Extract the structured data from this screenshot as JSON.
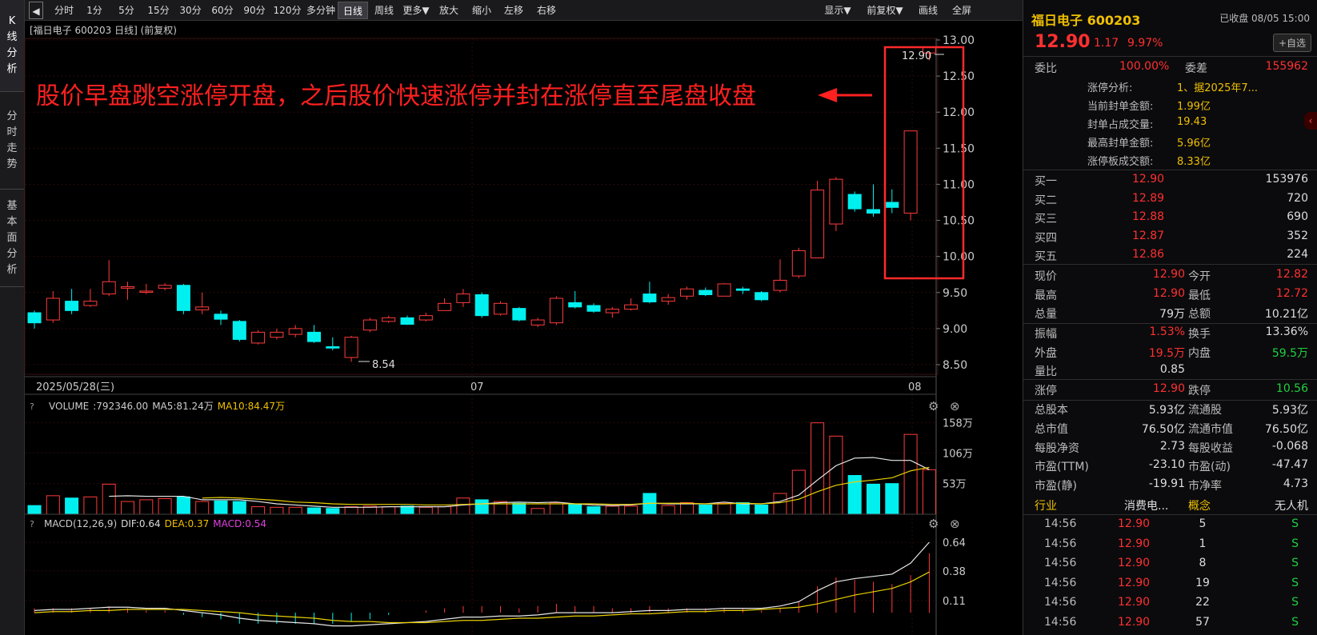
{
  "sidebar": {
    "tabs": [
      {
        "label": "K线分析",
        "active": true
      },
      {
        "label": "分时走势",
        "active": false
      },
      {
        "label": "基本面分析",
        "active": false
      }
    ]
  },
  "toolbar": {
    "left": [
      "分时",
      "1分",
      "5分",
      "15分",
      "30分",
      "60分",
      "90分",
      "120分",
      "多分钟",
      "日线",
      "周线",
      "更多▼",
      "放大",
      "缩小",
      "左移",
      "右移"
    ],
    "active": "日线",
    "right": [
      "显示▼",
      "前复权▼",
      "画线",
      "全屏"
    ]
  },
  "chart": {
    "title": "[福日电子 600203 日线]  (前复权)",
    "price_ticks": [
      "13.00",
      "12.50",
      "12.00",
      "11.50",
      "11.00",
      "10.50",
      "10.00",
      "9.50",
      "9.00",
      "8.50"
    ],
    "date_labels": [
      "2025/05/28(三)",
      "07",
      "08"
    ],
    "annotation": "股价早盘跳空涨停开盘，之后股价快速涨停并封在涨停直至尾盘收盘",
    "high_label": "12.90",
    "low_label": "8.54"
  },
  "volume": {
    "label": "VOLUME",
    "value": ":792346.00",
    "ma5": "MA5:81.24万",
    "ma10": "MA10:84.47万",
    "ticks": [
      "158万",
      "106万",
      "53万"
    ]
  },
  "macd": {
    "label": "MACD(12,26,9)",
    "dif": "DIF:0.64",
    "dea": "DEA:0.37",
    "macd": "MACD:0.54",
    "ticks": [
      "0.64",
      "0.38",
      "0.11"
    ]
  },
  "chart_data": {
    "type": "candlestick",
    "title": "福日电子 600203 日线",
    "y_range": [
      8.5,
      13.0
    ],
    "candles": [
      {
        "o": 9.22,
        "c": 9.08,
        "h": 9.25,
        "l": 9.0
      },
      {
        "o": 9.12,
        "c": 9.42,
        "h": 9.52,
        "l": 9.08
      },
      {
        "o": 9.38,
        "c": 9.25,
        "h": 9.55,
        "l": 9.2
      },
      {
        "o": 9.32,
        "c": 9.38,
        "h": 9.55,
        "l": 9.3
      },
      {
        "o": 9.48,
        "c": 9.65,
        "h": 9.95,
        "l": 9.45
      },
      {
        "o": 9.56,
        "c": 9.58,
        "h": 9.65,
        "l": 9.4
      },
      {
        "o": 9.52,
        "c": 9.52,
        "h": 9.62,
        "l": 9.48
      },
      {
        "o": 9.56,
        "c": 9.6,
        "h": 9.63,
        "l": 9.53
      },
      {
        "o": 9.6,
        "c": 9.25,
        "h": 9.62,
        "l": 9.2
      },
      {
        "o": 9.26,
        "c": 9.3,
        "h": 9.5,
        "l": 9.2
      },
      {
        "o": 9.2,
        "c": 9.13,
        "h": 9.25,
        "l": 9.05
      },
      {
        "o": 9.1,
        "c": 8.85,
        "h": 9.12,
        "l": 8.82
      },
      {
        "o": 8.8,
        "c": 8.95,
        "h": 8.98,
        "l": 8.78
      },
      {
        "o": 8.88,
        "c": 8.95,
        "h": 9.0,
        "l": 8.85
      },
      {
        "o": 8.92,
        "c": 9.0,
        "h": 9.05,
        "l": 8.88
      },
      {
        "o": 8.95,
        "c": 8.82,
        "h": 9.05,
        "l": 8.8
      },
      {
        "o": 8.75,
        "c": 8.73,
        "h": 8.88,
        "l": 8.7
      },
      {
        "o": 8.6,
        "c": 8.88,
        "h": 8.9,
        "l": 8.54
      },
      {
        "o": 8.98,
        "c": 9.12,
        "h": 9.15,
        "l": 8.95
      },
      {
        "o": 9.1,
        "c": 9.15,
        "h": 9.18,
        "l": 9.08
      },
      {
        "o": 9.15,
        "c": 9.06,
        "h": 9.18,
        "l": 9.05
      },
      {
        "o": 9.12,
        "c": 9.18,
        "h": 9.22,
        "l": 9.1
      },
      {
        "o": 9.25,
        "c": 9.35,
        "h": 9.42,
        "l": 9.25
      },
      {
        "o": 9.36,
        "c": 9.48,
        "h": 9.55,
        "l": 9.3
      },
      {
        "o": 9.47,
        "c": 9.18,
        "h": 9.5,
        "l": 9.15
      },
      {
        "o": 9.2,
        "c": 9.35,
        "h": 9.38,
        "l": 9.18
      },
      {
        "o": 9.28,
        "c": 9.12,
        "h": 9.3,
        "l": 9.1
      },
      {
        "o": 9.05,
        "c": 9.12,
        "h": 9.15,
        "l": 9.02
      },
      {
        "o": 9.08,
        "c": 9.42,
        "h": 9.45,
        "l": 9.05
      },
      {
        "o": 9.36,
        "c": 9.3,
        "h": 9.52,
        "l": 9.28
      },
      {
        "o": 9.32,
        "c": 9.24,
        "h": 9.35,
        "l": 9.22
      },
      {
        "o": 9.22,
        "c": 9.27,
        "h": 9.3,
        "l": 9.15
      },
      {
        "o": 9.27,
        "c": 9.33,
        "h": 9.42,
        "l": 9.25
      },
      {
        "o": 9.48,
        "c": 9.37,
        "h": 9.65,
        "l": 9.35
      },
      {
        "o": 9.38,
        "c": 9.43,
        "h": 9.48,
        "l": 9.33
      },
      {
        "o": 9.45,
        "c": 9.55,
        "h": 9.58,
        "l": 9.4
      },
      {
        "o": 9.53,
        "c": 9.47,
        "h": 9.57,
        "l": 9.45
      },
      {
        "o": 9.45,
        "c": 9.62,
        "h": 9.63,
        "l": 9.45
      },
      {
        "o": 9.55,
        "c": 9.53,
        "h": 9.58,
        "l": 9.48
      },
      {
        "o": 9.5,
        "c": 9.4,
        "h": 9.52,
        "l": 9.38
      },
      {
        "o": 9.53,
        "c": 9.67,
        "h": 9.96,
        "l": 9.5
      },
      {
        "o": 9.73,
        "c": 10.08,
        "h": 10.12,
        "l": 9.7
      },
      {
        "o": 9.98,
        "c": 10.92,
        "h": 11.05,
        "l": 9.98
      },
      {
        "o": 10.45,
        "c": 11.07,
        "h": 11.1,
        "l": 10.35
      },
      {
        "o": 10.86,
        "c": 10.66,
        "h": 10.9,
        "l": 10.62
      },
      {
        "o": 10.65,
        "c": 10.6,
        "h": 11.0,
        "l": 10.55
      },
      {
        "o": 10.75,
        "c": 10.68,
        "h": 10.93,
        "l": 10.6
      },
      {
        "o": 10.6,
        "c": 11.74,
        "h": 11.74,
        "l": 10.5
      },
      {
        "o": 12.82,
        "c": 12.9,
        "h": 12.9,
        "l": 12.72
      }
    ],
    "volume": [
      15,
      32,
      28,
      30,
      52,
      22,
      25,
      27,
      30,
      22,
      23,
      22,
      13,
      12,
      12,
      11,
      10,
      13,
      14,
      13,
      14,
      12,
      13,
      28,
      25,
      22,
      19,
      10,
      20,
      18,
      13,
      14,
      14,
      36,
      15,
      20,
      16,
      19,
      20,
      16,
      36,
      76,
      158,
      135,
      67,
      52,
      53,
      138,
      77
    ],
    "volume_ma5": [
      null,
      null,
      null,
      null,
      31,
      32,
      31,
      31,
      31,
      25,
      25,
      25,
      22,
      18,
      16,
      14,
      12,
      12,
      12,
      13,
      13,
      13,
      13,
      16,
      18,
      20,
      21,
      20,
      21,
      18,
      16,
      15,
      16,
      19,
      18,
      18,
      18,
      21,
      18,
      18,
      22,
      33,
      59,
      84,
      97,
      98,
      93,
      93,
      77
    ],
    "volume_ma10": [
      null,
      null,
      null,
      null,
      null,
      null,
      null,
      null,
      null,
      28,
      29,
      28,
      26,
      24,
      21,
      20,
      18,
      17,
      17,
      17,
      17,
      16,
      16,
      17,
      18,
      18,
      18,
      18,
      18,
      18,
      18,
      17,
      17,
      19,
      19,
      19,
      18,
      18,
      19,
      18,
      20,
      26,
      39,
      50,
      56,
      59,
      63,
      75,
      81
    ],
    "macd": {
      "dif": [
        0.02,
        0.03,
        0.03,
        0.04,
        0.05,
        0.05,
        0.04,
        0.04,
        0.02,
        0.0,
        -0.02,
        -0.05,
        -0.07,
        -0.08,
        -0.09,
        -0.1,
        -0.12,
        -0.12,
        -0.11,
        -0.1,
        -0.09,
        -0.08,
        -0.06,
        -0.04,
        -0.04,
        -0.03,
        -0.03,
        -0.02,
        0.0,
        0.0,
        0.0,
        0.0,
        0.01,
        0.02,
        0.02,
        0.03,
        0.03,
        0.04,
        0.04,
        0.04,
        0.06,
        0.1,
        0.2,
        0.28,
        0.31,
        0.33,
        0.35,
        0.45,
        0.64
      ],
      "dea": [
        0.0,
        0.01,
        0.01,
        0.02,
        0.02,
        0.03,
        0.03,
        0.03,
        0.03,
        0.02,
        0.01,
        0.0,
        -0.02,
        -0.03,
        -0.04,
        -0.05,
        -0.07,
        -0.08,
        -0.08,
        -0.09,
        -0.09,
        -0.09,
        -0.08,
        -0.07,
        -0.07,
        -0.06,
        -0.05,
        -0.05,
        -0.04,
        -0.03,
        -0.03,
        -0.02,
        -0.01,
        -0.01,
        0.0,
        0.01,
        0.01,
        0.02,
        0.02,
        0.03,
        0.04,
        0.05,
        0.08,
        0.12,
        0.16,
        0.19,
        0.22,
        0.28,
        0.37
      ],
      "hist": [
        0.04,
        0.04,
        0.04,
        0.04,
        0.06,
        0.04,
        0.02,
        0.02,
        -0.02,
        -0.04,
        -0.06,
        -0.1,
        -0.1,
        -0.1,
        -0.1,
        -0.1,
        -0.1,
        -0.08,
        -0.06,
        -0.02,
        0.0,
        0.02,
        0.04,
        0.06,
        0.06,
        0.06,
        0.04,
        0.06,
        0.08,
        0.06,
        0.06,
        0.04,
        0.04,
        0.06,
        0.04,
        0.04,
        0.04,
        0.04,
        0.04,
        0.02,
        0.04,
        0.1,
        0.24,
        0.32,
        0.3,
        0.28,
        0.26,
        0.34,
        0.54
      ]
    }
  },
  "panel": {
    "title": "福日电子 600203",
    "status": "已收盘 08/05 15:00",
    "price": "12.90",
    "change": "1.17",
    "pct": "9.97%",
    "fav": "+自选",
    "weibi_label": "委比",
    "weibi": "100.00%",
    "weicha_label": "委差",
    "weicha": "155962",
    "limit_info": [
      {
        "k": "涨停分析:",
        "v": "1、据2025年7..."
      },
      {
        "k": "当前封单金额:",
        "v": "1.99亿"
      },
      {
        "k": "封单占成交量:",
        "v": "19.43"
      },
      {
        "k": "最高封单金额:",
        "v": "5.96亿"
      },
      {
        "k": "涨停板成交额:",
        "v": "8.33亿"
      }
    ],
    "bids": [
      {
        "label": "买一",
        "price": "12.90",
        "vol": "153976"
      },
      {
        "label": "买二",
        "price": "12.89",
        "vol": "720"
      },
      {
        "label": "买三",
        "price": "12.88",
        "vol": "690"
      },
      {
        "label": "买四",
        "price": "12.87",
        "vol": "352"
      },
      {
        "label": "买五",
        "price": "12.86",
        "vol": "224"
      }
    ],
    "stats1": [
      {
        "l1": "现价",
        "v1": "12.90",
        "l2": "今开",
        "v2": "12.82"
      },
      {
        "l1": "最高",
        "v1": "12.90",
        "l2": "最低",
        "v2": "12.72"
      },
      {
        "l1": "总量",
        "v1": "79万",
        "l2": "总额",
        "v2": "10.21亿"
      }
    ],
    "stats2": [
      {
        "l1": "振幅",
        "v1": "1.53%",
        "l2": "换手",
        "v2": "13.36%"
      },
      {
        "l1": "外盘",
        "v1": "19.5万",
        "l2": "内盘",
        "v2": "59.5万"
      },
      {
        "l1": "量比",
        "v1": "0.85",
        "l2": "",
        "v2": ""
      }
    ],
    "limit_row": {
      "l1": "涨停",
      "v1": "12.90",
      "l2": "跌停",
      "v2": "10.56"
    },
    "fund": [
      {
        "l1": "总股本",
        "v1": "5.93亿",
        "l2": "流通股",
        "v2": "5.93亿"
      },
      {
        "l1": "总市值",
        "v1": "76.50亿",
        "l2": "流通市值",
        "v2": "76.50亿"
      },
      {
        "l1": "每股净资",
        "v1": "2.73",
        "l2": "每股收益",
        "v2": "-0.068"
      },
      {
        "l1": "市盈(TTM)",
        "v1": "-23.10",
        "l2": "市盈(动)",
        "v2": "-47.47"
      },
      {
        "l1": "市盈(静)",
        "v1": "-19.91",
        "l2": "市净率",
        "v2": "4.73"
      }
    ],
    "industry": {
      "l1": "行业",
      "v1": "消费电...",
      "l2": "概念",
      "v2": "无人机"
    },
    "ticks": [
      {
        "t": "14:56",
        "p": "12.90",
        "v": "5",
        "s": "S"
      },
      {
        "t": "14:56",
        "p": "12.90",
        "v": "1",
        "s": "S"
      },
      {
        "t": "14:56",
        "p": "12.90",
        "v": "8",
        "s": "S"
      },
      {
        "t": "14:56",
        "p": "12.90",
        "v": "19",
        "s": "S"
      },
      {
        "t": "14:56",
        "p": "12.90",
        "v": "22",
        "s": "S"
      },
      {
        "t": "14:56",
        "p": "12.90",
        "v": "57",
        "s": "S"
      }
    ]
  }
}
